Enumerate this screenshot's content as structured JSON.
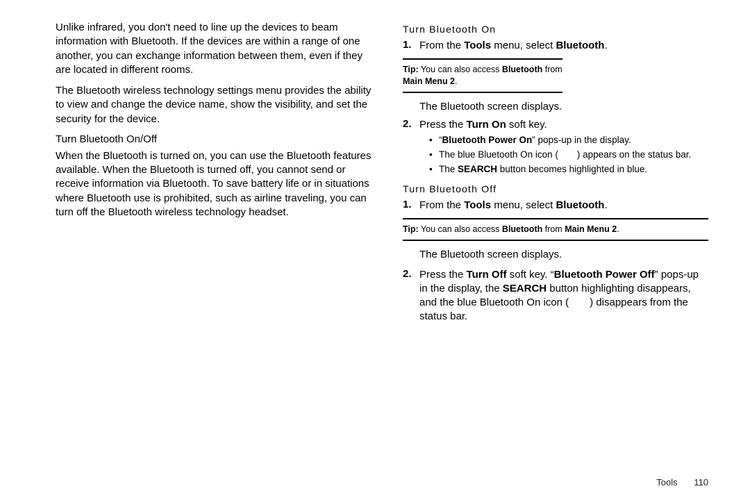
{
  "left": {
    "para1": "Unlike infrared, you don't need to line up the devices to beam information with Bluetooth. If the devices are within a range of one another, you can exchange information between them, even if they are located in different rooms.",
    "para2": "The Bluetooth wireless technology settings menu provides the ability to view and change the device name, show the visibility, and set the security for the device.",
    "subhead": "Turn Bluetooth On/Off",
    "para3": "When the Bluetooth is turned on, you can use the Bluetooth features available. When the Bluetooth is turned off, you cannot send or receive information via Bluetooth. To save battery life or in situations where Bluetooth use is prohibited, such as airline traveling, you can turn off the Bluetooth wireless technology headset."
  },
  "right": {
    "head_on": "Turn Bluetooth On",
    "on_step1_pre": "From the ",
    "on_step1_bold1": "Tools",
    "on_step1_mid": " menu, select ",
    "on_step1_bold2": "Bluetooth",
    "on_step1_end": ".",
    "tip1_pre": "Tip:",
    "tip1_body_a": " You can also access ",
    "tip1_bold": "Bluetooth",
    "tip1_body_b": " from ",
    "tip1_bold2": "Main Menu 2",
    "tip1_end": ".",
    "on_after_tip": "The Bluetooth screen displays.",
    "on_step2_pre": "Press the ",
    "on_step2_bold": "Turn On",
    "on_step2_post": " soft key.",
    "on_bullet1_a": "“",
    "on_bullet1_bold": "Bluetooth Power On",
    "on_bullet1_b": "” pops-up in the display.",
    "on_bullet2": "The blue Bluetooth On icon (  ) appears on the status bar.",
    "on_bullet3_a": "The ",
    "on_bullet3_bold": "SEARCH",
    "on_bullet3_b": " button becomes highlighted in blue.",
    "head_off": "Turn Bluetooth Off",
    "off_step1_pre": "From the ",
    "off_step1_bold1": "Tools",
    "off_step1_mid": " menu, select ",
    "off_step1_bold2": "Bluetooth",
    "off_step1_end": ".",
    "tip2_pre": "Tip:",
    "tip2_body_a": " You can also access ",
    "tip2_bold": "Bluetooth",
    "tip2_body_b": " from ",
    "tip2_bold2": "Main Menu 2",
    "tip2_end": ".",
    "off_after_tip": "The Bluetooth screen displays.",
    "off_step2_a": "Press the ",
    "off_step2_bold1": "Turn Off",
    "off_step2_b": " soft key. “",
    "off_step2_bold2": "Bluetooth Power Off",
    "off_step2_c": "” pops-up in the display, the ",
    "off_step2_bold3": "SEARCH",
    "off_step2_d": " button highlighting disappears, and the blue Bluetooth On icon (  ) disappears from the status bar."
  },
  "footer": {
    "section": "Tools",
    "page": "110"
  },
  "markers": {
    "one": "1.",
    "two": "2.",
    "dot": "•"
  }
}
